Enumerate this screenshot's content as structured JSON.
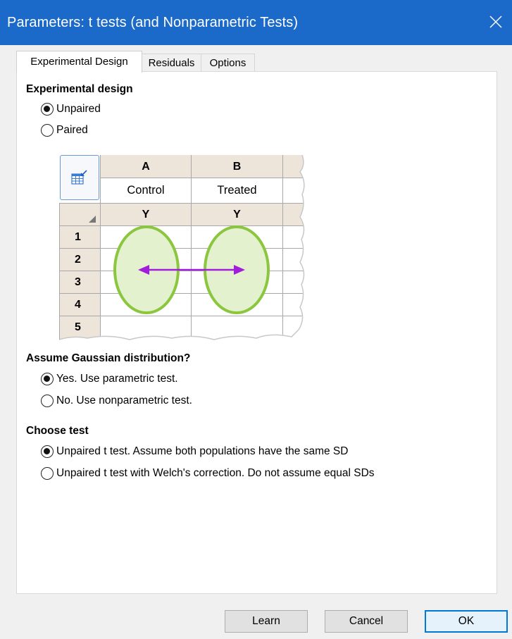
{
  "window": {
    "title": "Parameters: t tests (and Nonparametric Tests)"
  },
  "tabs": [
    {
      "label": "Experimental Design",
      "active": true
    },
    {
      "label": "Residuals",
      "active": false
    },
    {
      "label": "Options",
      "active": false
    }
  ],
  "experimental_design": {
    "heading": "Experimental design",
    "options": [
      {
        "label": "Unpaired",
        "checked": true
      },
      {
        "label": "Paired",
        "checked": false
      }
    ]
  },
  "datasheet": {
    "columns": [
      {
        "letter": "A",
        "title": "Control",
        "type": "Y"
      },
      {
        "letter": "B",
        "title": "Treated",
        "type": "Y"
      }
    ],
    "rows": [
      "1",
      "2",
      "3",
      "4",
      "5"
    ]
  },
  "gaussian": {
    "heading": "Assume Gaussian distribution?",
    "options": [
      {
        "label": "Yes. Use parametric test.",
        "checked": true
      },
      {
        "label": "No. Use nonparametric test.",
        "checked": false
      }
    ]
  },
  "choose_test": {
    "heading": "Choose test",
    "options": [
      {
        "label": "Unpaired t test. Assume both populations have the same SD",
        "checked": true
      },
      {
        "label": "Unpaired t test with Welch's correction. Do not assume equal SDs",
        "checked": false
      }
    ]
  },
  "buttons": {
    "learn": "Learn",
    "cancel": "Cancel",
    "ok": "OK"
  },
  "colors": {
    "titlebar": "#1b6ac9",
    "header_fill": "#ede5d9",
    "ellipse": "#8cc63f",
    "arrow": "#a21cdb"
  }
}
